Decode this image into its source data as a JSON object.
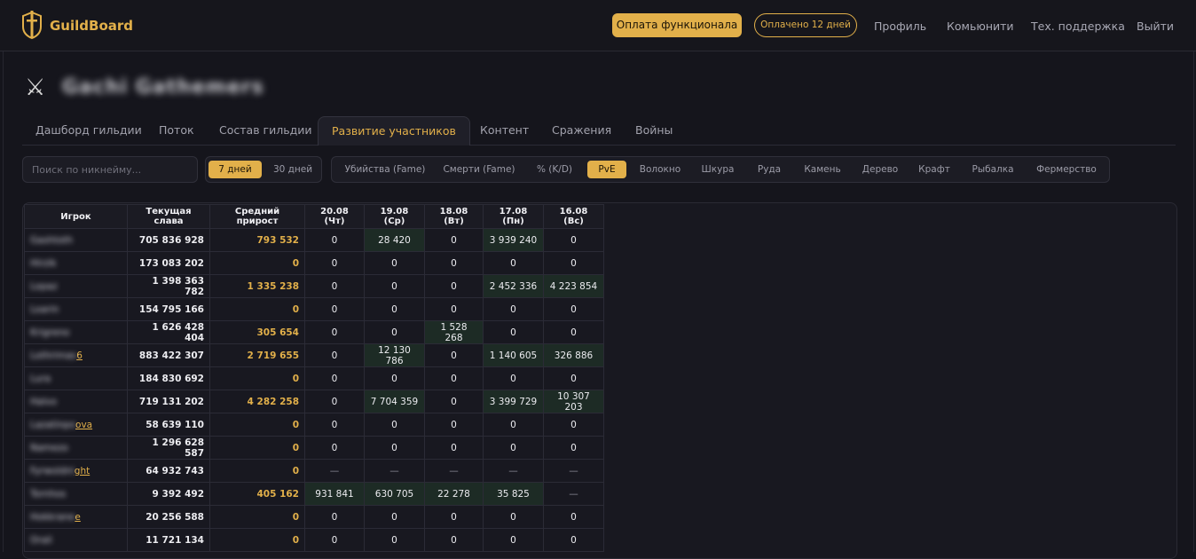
{
  "brand": {
    "name": "GuildBoard"
  },
  "header": {
    "pay_button": "Оплата функционала",
    "paid_badge": "Оплачено 12 дней",
    "nav": [
      "Профиль",
      "Комьюнити",
      "Тех. поддержка",
      "Выйти"
    ]
  },
  "guild": {
    "name": "Gachi Gathemers",
    "icon": "crossed-swords-icon"
  },
  "tabs": [
    "Дашборд гильдии",
    "Поток",
    "Состав гильдии",
    "Развитие участников",
    "Контент",
    "Сражения",
    "Войны"
  ],
  "active_tab": "Развитие участников",
  "search": {
    "placeholder": "Поиск по никнейму..."
  },
  "period": {
    "options": [
      "7 дней",
      "30 дней"
    ],
    "active": "7 дней"
  },
  "categories": {
    "options": [
      "Убийства (Fame)",
      "Смерти (Fame)",
      "% (K/D)",
      "PvE",
      "Волокно",
      "Шкура",
      "Руда",
      "Камень",
      "Дерево",
      "Крафт",
      "Рыбалка",
      "Фермерство"
    ],
    "active": "PvE"
  },
  "table": {
    "headers": [
      "Игрок",
      "Текущая слава",
      "Средний прирост",
      "20.08 (Чт)",
      "19.08 (Ср)",
      "18.08 (Вт)",
      "17.08 (Пн)",
      "16.08 (Вс)"
    ],
    "rows": [
      {
        "player": "Gashtoth",
        "tail": "",
        "fame": "705 836 928",
        "gain": "793 532",
        "days": [
          "0",
          "28 420",
          "0",
          "3 939 240",
          "0"
        ]
      },
      {
        "player": "Hirzik",
        "tail": "",
        "fame": "173 083 202",
        "gain": "0",
        "days": [
          "0",
          "0",
          "0",
          "0",
          "0"
        ]
      },
      {
        "player": "Lopaz",
        "tail": "",
        "fame": "1 398 363 782",
        "gain": "1 335 238",
        "days": [
          "0",
          "0",
          "0",
          "2 452 336",
          "4 223 854"
        ]
      },
      {
        "player": "Loarin",
        "tail": "",
        "fame": "154 795 166",
        "gain": "0",
        "days": [
          "0",
          "0",
          "0",
          "0",
          "0"
        ]
      },
      {
        "player": "Krigreno",
        "tail": "",
        "fame": "1 626 428 404",
        "gain": "305 654",
        "days": [
          "0",
          "0",
          "1 528 268",
          "0",
          "0"
        ]
      },
      {
        "player": "Lothrimas",
        "tail": "6",
        "fame": "883 422 307",
        "gain": "2 719 655",
        "days": [
          "0",
          "12 130 786",
          "0",
          "1 140 605",
          "326 886"
        ]
      },
      {
        "player": "Lura",
        "tail": "",
        "fame": "184 830 692",
        "gain": "0",
        "days": [
          "0",
          "0",
          "0",
          "0",
          "0"
        ]
      },
      {
        "player": "Halvo",
        "tail": "",
        "fame": "719 131 202",
        "gain": "4 282 258",
        "days": [
          "0",
          "7 704 359",
          "0",
          "3 399 729",
          "10 307 203"
        ]
      },
      {
        "player": "Lazatinpo",
        "tail": "ova",
        "fame": "58 639 110",
        "gain": "0",
        "days": [
          "0",
          "0",
          "0",
          "0",
          "0"
        ]
      },
      {
        "player": "Namezo",
        "tail": "",
        "fame": "1 296 628 587",
        "gain": "0",
        "days": [
          "0",
          "0",
          "0",
          "0",
          "0"
        ]
      },
      {
        "player": "Fyrwoldni",
        "tail": "ght",
        "fame": "64 932 743",
        "gain": "0",
        "days": [
          "—",
          "—",
          "—",
          "—",
          "—"
        ]
      },
      {
        "player": "Tornhos",
        "tail": "",
        "fame": "9 392 492",
        "gain": "405 162",
        "days": [
          "931 841",
          "630 705",
          "22 278",
          "35 825",
          "—"
        ]
      },
      {
        "player": "Hokkrane",
        "tail": "e",
        "fame": "20 256 588",
        "gain": "0",
        "days": [
          "0",
          "0",
          "0",
          "0",
          "0"
        ]
      },
      {
        "player": "Orali",
        "tail": "",
        "fame": "11 721 134",
        "gain": "0",
        "days": [
          "0",
          "0",
          "0",
          "0",
          "0"
        ]
      }
    ]
  },
  "colors": {
    "accent": "#e2b04a",
    "background": "#15151c",
    "highlight_cell": "#1d2b25"
  }
}
